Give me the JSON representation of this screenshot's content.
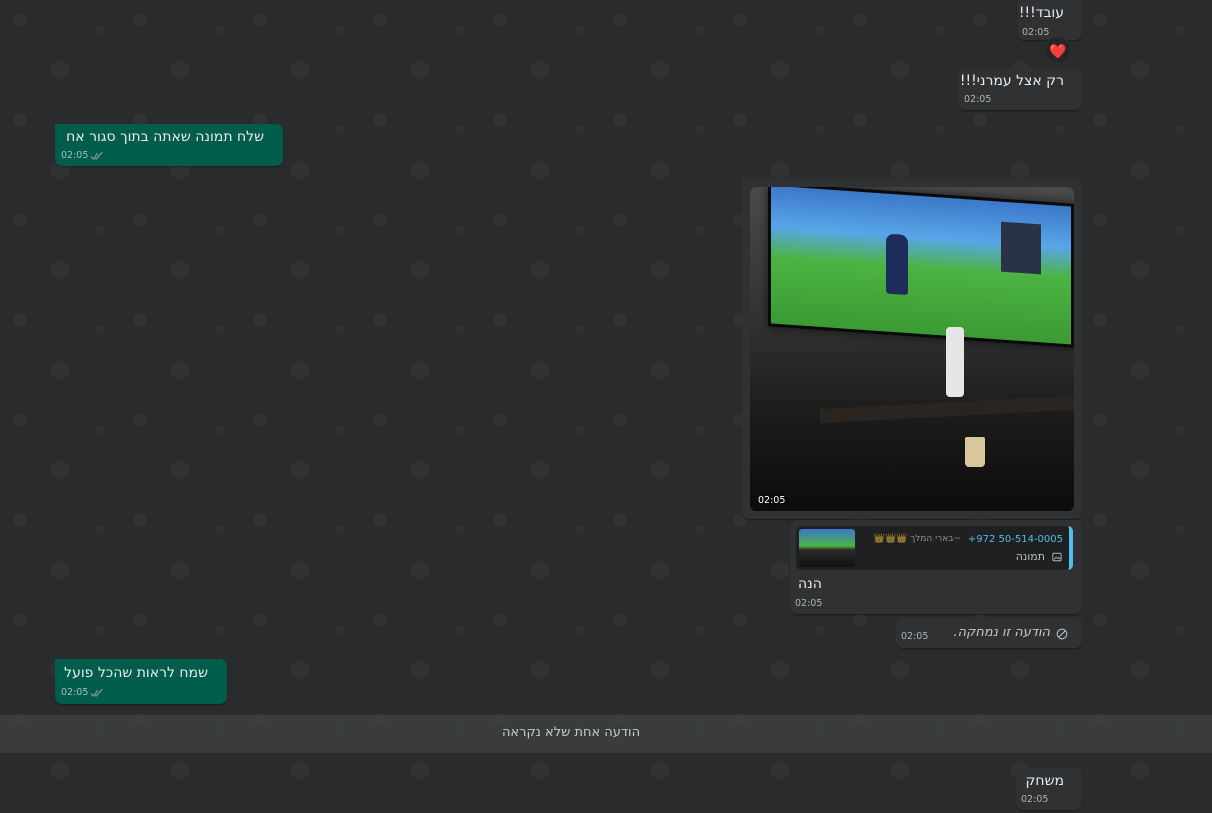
{
  "messages": [
    {
      "type": "incoming",
      "text": "עובד!!!",
      "time": "02:05",
      "reaction": "❤️"
    },
    {
      "type": "incoming",
      "text": "רק אצל עמרני!!!",
      "time": "02:05"
    },
    {
      "type": "outgoing",
      "text": "שלח תמונה שאתה בתוך סגור אח",
      "time": "02:05",
      "status": "read"
    },
    {
      "type": "incoming-image",
      "time": "02:05"
    },
    {
      "type": "incoming-reply",
      "quote": {
        "sender": "+972 50-514-0005",
        "alias": "~בארי המלך 👑👑👑",
        "text": "תמונה",
        "icon": "camera-icon"
      },
      "text": "הנה",
      "time": "02:05"
    },
    {
      "type": "incoming-deleted",
      "text": "הודעה זו נמחקה.",
      "time": "02:05"
    },
    {
      "type": "outgoing",
      "text": "שמח לראות שהכל פועל",
      "time": "02:05",
      "status": "read"
    },
    {
      "type": "incoming",
      "text": "משחק",
      "time": "02:05"
    }
  ],
  "unread_divider": "הודעה אחת שלא נקראה",
  "colors": {
    "incoming_bubble": "#2f3133",
    "outgoing_bubble": "#005c4b",
    "reply_accent": "#53bdeb",
    "chat_background": "#2a2b2c"
  }
}
